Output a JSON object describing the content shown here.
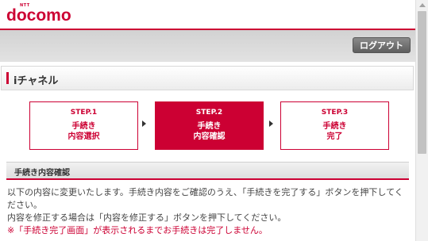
{
  "header": {
    "logo_ntt": "NTT",
    "logo_text": "docomo",
    "logout_label": "ログアウト"
  },
  "page": {
    "title": "iチャネル"
  },
  "steps": [
    {
      "num": "STEP.1",
      "line1": "手続き",
      "line2": "内容選択",
      "active": false
    },
    {
      "num": "STEP.2",
      "line1": "手続き",
      "line2": "内容確認",
      "active": true
    },
    {
      "num": "STEP.3",
      "line1": "手続き",
      "line2": "完了",
      "active": false
    }
  ],
  "section": {
    "title": "手続き内容確認"
  },
  "body": {
    "line1": "以下の内容に変更いたします。手続き内容をご確認のうえ、「手続きを完了する」ボタンを押下してください。",
    "line2": "内容を修正する場合は「内容を修正する」ボタンを押下してください。",
    "note": "※「手続き完了画面」が表示されるまでお手続きは完了しません。"
  },
  "colors": {
    "brand": "#cc0033",
    "logout_button": "#6f6f6f"
  },
  "icons": [
    "step-arrow-icon",
    "scroll-up-arrow-icon"
  ]
}
